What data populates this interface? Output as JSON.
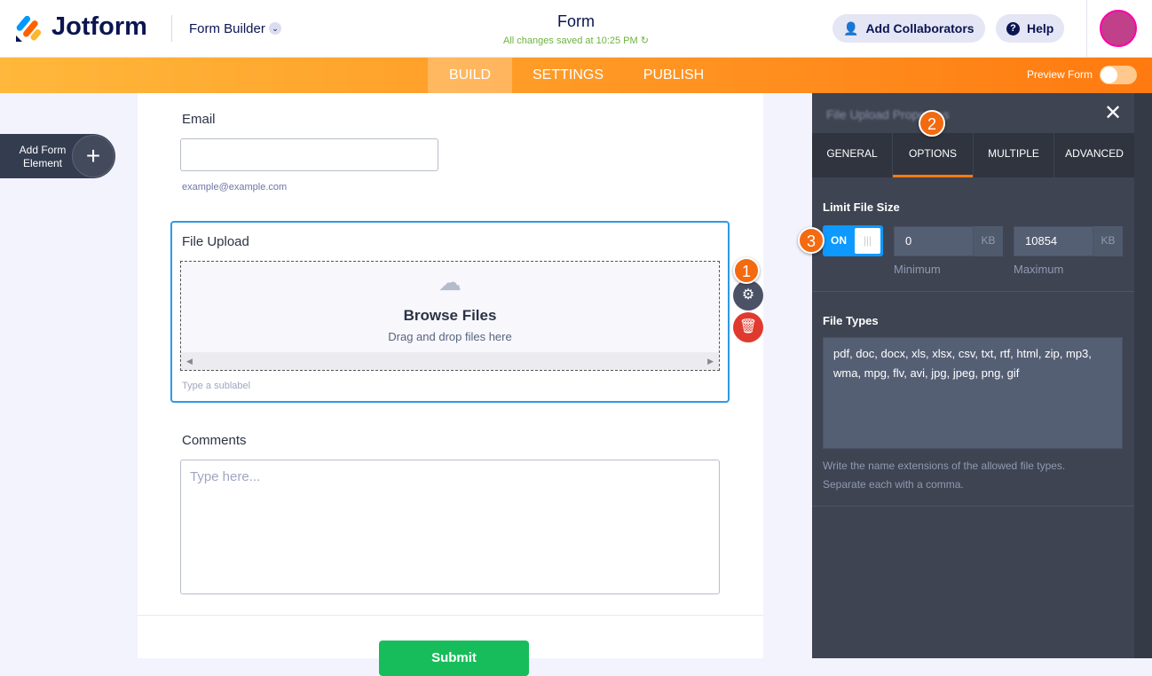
{
  "header": {
    "logo": "Jotform",
    "product": "Form Builder",
    "form_title": "Form",
    "saved_status": "All changes saved at 10:25 PM",
    "add_collaborators": "Add Collaborators",
    "help": "Help"
  },
  "nav": {
    "tabs": [
      "BUILD",
      "SETTINGS",
      "PUBLISH"
    ],
    "active": "BUILD",
    "preview_label": "Preview Form",
    "preview_on": false
  },
  "sidebar": {
    "add_element": "Add Form Element"
  },
  "form": {
    "email_label": "Email",
    "email_value": "",
    "email_sublabel": "example@example.com",
    "upload_label": "File Upload",
    "browse": "Browse Files",
    "drag": "Drag and drop files here",
    "upload_sublabel": "Type a sublabel",
    "comments_label": "Comments",
    "comments_placeholder": "Type here...",
    "submit": "Submit"
  },
  "badges": [
    "1",
    "2",
    "3"
  ],
  "panel": {
    "title": "File Upload Properties",
    "tabs": [
      "GENERAL",
      "OPTIONS",
      "MULTIPLE",
      "ADVANCED"
    ],
    "active_tab": "OPTIONS",
    "limit_label": "Limit File Size",
    "toggle": "ON",
    "min_value": "0",
    "max_value": "10854",
    "unit": "KB",
    "min_label": "Minimum",
    "max_label": "Maximum",
    "types_label": "File Types",
    "types_value": "pdf, doc, docx, xls, xlsx, csv, txt, rtf, html, zip, mp3, wma, mpg, flv, avi, jpg, jpeg, png, gif",
    "hint1": "Write the name extensions of the allowed file types.",
    "hint2": "Separate each with a comma."
  }
}
